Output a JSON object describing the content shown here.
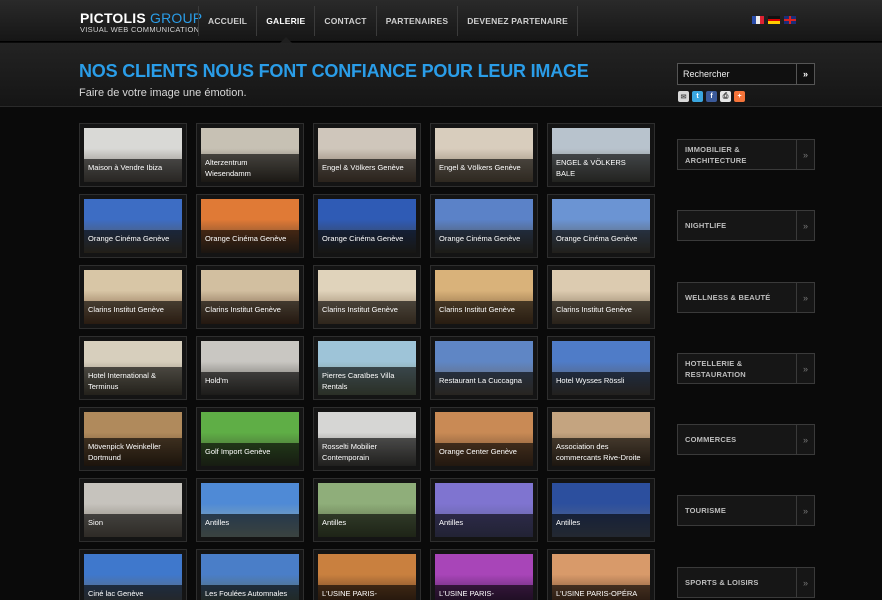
{
  "brand": {
    "name": "PICTOLIS",
    "group": "GROUP",
    "tagline": "VISUAL WEB COMMUNICATION"
  },
  "nav": [
    {
      "label": "ACCUEIL",
      "active": false
    },
    {
      "label": "GALERIE",
      "active": true
    },
    {
      "label": "CONTACT",
      "active": false
    },
    {
      "label": "PARTENAIRES",
      "active": false
    },
    {
      "label": "DEVENEZ PARTENAIRE",
      "active": false
    }
  ],
  "languages": [
    "fr-flag-icon",
    "de-flag-icon",
    "en-flag-icon"
  ],
  "header": {
    "title": "NOS CLIENTS NOUS FONT CONFIANCE POUR LEUR IMAGE",
    "subtitle": "Faire de votre image une émotion."
  },
  "search": {
    "placeholder": "Rechercher",
    "button": "»"
  },
  "share": [
    "email-icon",
    "twitter-icon",
    "facebook-icon",
    "print-icon",
    "addthis-icon"
  ],
  "colors": {
    "accent": "#2a9de8",
    "background": "#0a0a0a"
  },
  "gallery": [
    [
      {
        "caption": "Maison à Vendre Ibiza",
        "sky": "#d9d9d6",
        "ground": "#6a645c"
      },
      {
        "caption": "Alterzentrum Wiesendamm",
        "sky": "#c7c1b4",
        "ground": "#4a4338"
      },
      {
        "caption": "Engel & Völkers Genève",
        "sky": "#cfc6bb",
        "ground": "#715d4b"
      },
      {
        "caption": "Engel & Völkers Genève",
        "sky": "#d8cdbd",
        "ground": "#7b6b56"
      },
      {
        "caption": "ENGEL & VÖLKERS BALE",
        "sky": "#b8c3cd",
        "ground": "#5c5d55"
      }
    ],
    [
      {
        "caption": "Orange Cinéma Genève",
        "sky": "#3d6dc4",
        "ground": "#5a5240"
      },
      {
        "caption": "Orange Cinéma Genève",
        "sky": "#e07a36",
        "ground": "#4a3a2e"
      },
      {
        "caption": "Orange Cinéma Genève",
        "sky": "#2f5bb5",
        "ground": "#3e3c34"
      },
      {
        "caption": "Orange Cinéma Genève",
        "sky": "#5b82c8",
        "ground": "#4d4a3c"
      },
      {
        "caption": "Orange Cinéma Genève",
        "sky": "#6b94d3",
        "ground": "#595549"
      }
    ],
    [
      {
        "caption": "Clarins Institut Genève",
        "sky": "#d8c6a6",
        "ground": "#6e4a2e"
      },
      {
        "caption": "Clarins Institut Genève",
        "sky": "#d2bfa0",
        "ground": "#5e3f2a"
      },
      {
        "caption": "Clarins Institut Genève",
        "sky": "#e0d3bb",
        "ground": "#7c6449"
      },
      {
        "caption": "Clarins Institut Genève",
        "sky": "#d9b27a",
        "ground": "#6a4b2d"
      },
      {
        "caption": "Clarins Institut Genève",
        "sky": "#dccbb0",
        "ground": "#6d5a44"
      }
    ],
    [
      {
        "caption": "Hotel International & Terminus",
        "sky": "#d7cfbd",
        "ground": "#5e5848"
      },
      {
        "caption": "Hold'm",
        "sky": "#c9c7c2",
        "ground": "#4c4a45"
      },
      {
        "caption": "Pierres Caraïbes Villa Rentals",
        "sky": "#9ec4d8",
        "ground": "#6f7c64"
      },
      {
        "caption": "Restaurant La Cuccagna",
        "sky": "#5f86c5",
        "ground": "#6a6256"
      },
      {
        "caption": "Hotel Wysses Rössli",
        "sky": "#4f7cc8",
        "ground": "#5c5750"
      }
    ],
    [
      {
        "caption": "Mövenpick Weinkeller Dortmund",
        "sky": "#b08a5c",
        "ground": "#4a3420"
      },
      {
        "caption": "Golf Import Genève",
        "sky": "#5fae46",
        "ground": "#3d4a30"
      },
      {
        "caption": "Rosselti Mobilier Contemporain",
        "sky": "#d6d6d4",
        "ground": "#555450"
      },
      {
        "caption": "Orange Center Genève",
        "sky": "#c98a55",
        "ground": "#5a3f2a"
      },
      {
        "caption": "Association des commercants Rive-Droite",
        "sky": "#c4a480",
        "ground": "#4c3b2a"
      }
    ],
    [
      {
        "caption": "Sion",
        "sky": "#c6c3bd",
        "ground": "#7a7266"
      },
      {
        "caption": "Antilles",
        "sky": "#4f8ad6",
        "ground": "#9ab0a8"
      },
      {
        "caption": "Antilles",
        "sky": "#8fae7a",
        "ground": "#4f5e3c"
      },
      {
        "caption": "Antilles",
        "sky": "#7f74d0",
        "ground": "#5a5c8a"
      },
      {
        "caption": "Antilles",
        "sky": "#2c4f9e",
        "ground": "#5e6b82"
      }
    ],
    [
      {
        "caption": "Ciné lac Genève",
        "sky": "#3f78cc",
        "ground": "#6a6456"
      },
      {
        "caption": "Les Foulées Automnales",
        "sky": "#4a7ec8",
        "ground": "#5d6a4a"
      },
      {
        "caption": "L'USINE PARIS-",
        "sky": "#c9803f",
        "ground": "#4a2e1c"
      },
      {
        "caption": "L'USINE PARIS-",
        "sky": "#a845b8",
        "ground": "#3c1e48"
      },
      {
        "caption": "L'USINE PARIS-OPÉRA",
        "sky": "#d89a6a",
        "ground": "#5a3824"
      }
    ]
  ],
  "categories": [
    "IMMOBILIER & ARCHITECTURE",
    "NIGHTLIFE",
    "WELLNESS & BEAUTÉ",
    "HOTELLERIE & RESTAURATION",
    "COMMERCES",
    "TOURISME",
    "SPORTS & LOISIRS"
  ],
  "category_arrow": "»"
}
